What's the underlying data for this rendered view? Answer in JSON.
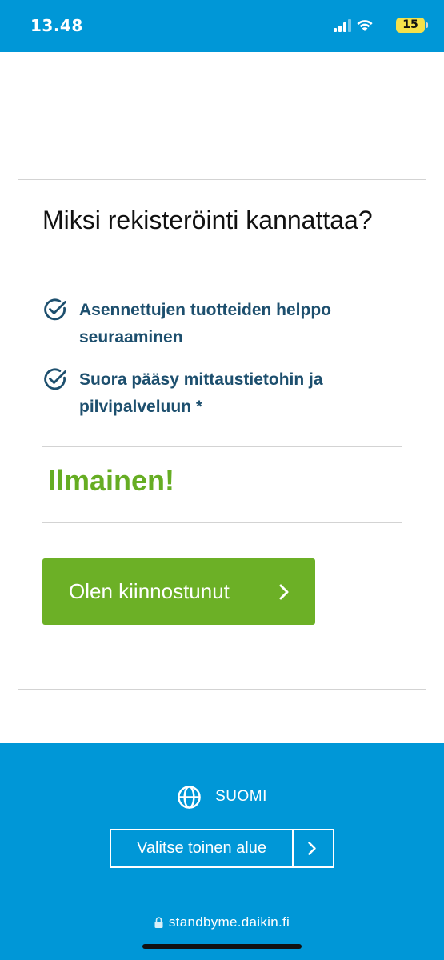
{
  "status_bar": {
    "time": "13.48",
    "battery": "15",
    "icons": [
      "signal-icon",
      "wifi-icon",
      "battery-icon"
    ]
  },
  "card": {
    "title": "Miksi rekisteröinti kannattaa?",
    "benefits": [
      {
        "icon": "check-circle-icon",
        "text": "Asennettujen tuotteiden helppo seuraaminen"
      },
      {
        "icon": "check-circle-icon",
        "text": "Suora pääsy mittaustietohin ja pilvipalveluun *"
      }
    ],
    "free_label": "Ilmainen!",
    "cta_label": "Olen kiinnostunut"
  },
  "footer": {
    "language": "SUOMI",
    "region_button_label": "Valitse toinen alue"
  },
  "browser": {
    "url": "standbyme.daikin.fi"
  },
  "colors": {
    "brand_blue": "#0097d7",
    "accent_green": "#6cb026",
    "free_green": "#66ad23",
    "benefit_text": "#1d4f6e"
  }
}
